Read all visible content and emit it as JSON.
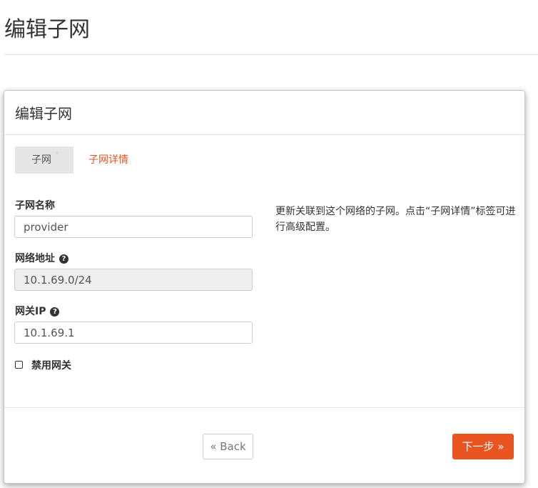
{
  "page": {
    "title": "编辑子网"
  },
  "modal": {
    "title": "编辑子网",
    "tabs": [
      {
        "label": "子网",
        "required_mark": "*",
        "active": true
      },
      {
        "label": "子网详情",
        "active": false
      }
    ],
    "fields": {
      "subnet_name": {
        "label": "子网名称",
        "value": "provider"
      },
      "network_address": {
        "label": "网络地址",
        "value": "10.1.69.0/24"
      },
      "gateway_ip": {
        "label": "网关IP",
        "value": "10.1.69.1"
      },
      "disable_gateway": {
        "label": "禁用网关",
        "checked": false
      }
    },
    "help_text": "更新关联到这个网络的子网。点击“子网详情”标签可进行高级配置。",
    "buttons": {
      "back": "« Back",
      "next": "下一步 »"
    }
  },
  "colors": {
    "accent": "#e95420",
    "tab_bg": "#e6e6e6"
  },
  "icons": {
    "help": "question-circle-icon",
    "checkbox": "checkbox-icon"
  }
}
